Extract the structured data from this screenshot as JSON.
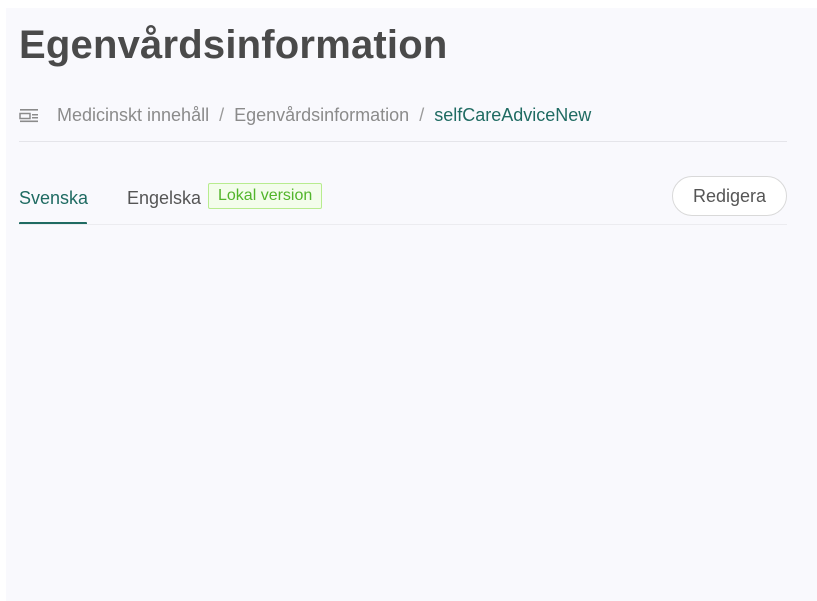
{
  "page": {
    "title": "Egenvårdsinformation"
  },
  "breadcrumb": {
    "icon": "list-menu-icon",
    "items": [
      {
        "label": "Medicinskt innehåll"
      },
      {
        "label": "Egenvårdsinformation"
      },
      {
        "label": "selfCareAdviceNew"
      }
    ],
    "separator": "/"
  },
  "tabs": [
    {
      "label": "Svenska",
      "active": true
    },
    {
      "label": "Engelska",
      "active": false,
      "badge": "Lokal version"
    }
  ],
  "actions": {
    "edit_label": "Redigera"
  },
  "colors": {
    "accent": "#1f6b62",
    "badge_text": "#52b52b",
    "badge_border": "#b8ec8f",
    "badge_bg": "#f3fdeb",
    "background": "#f9f9fd"
  }
}
